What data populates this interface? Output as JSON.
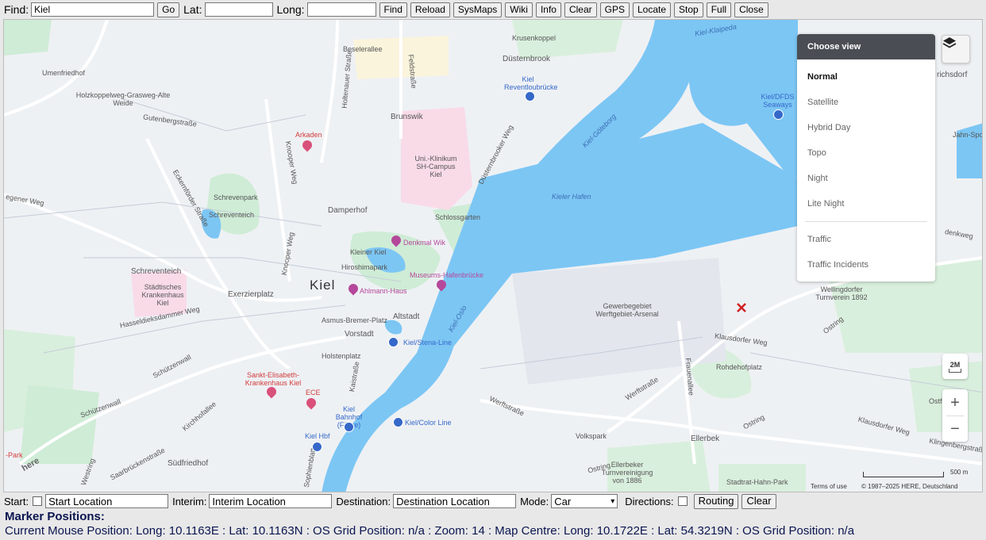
{
  "toolbar": {
    "find_label": "Find:",
    "find_value": "Kiel",
    "go": "Go",
    "lat_label": "Lat:",
    "lat_value": "",
    "long_label": "Long:",
    "long_value": "",
    "find_btn": "Find",
    "reload": "Reload",
    "sysmaps": "SysMaps",
    "wiki": "Wiki",
    "info": "Info",
    "clear": "Clear",
    "gps": "GPS",
    "locate": "Locate",
    "stop": "Stop",
    "full": "Full",
    "close": "Close"
  },
  "map": {
    "city": "Kiel",
    "labels": {
      "dusternbrook": "Düsternbrook",
      "brunswik": "Brunswik",
      "damperhof": "Damperhof",
      "schreventeich": "Schreventeich",
      "exerzierplatz": "Exerzierplatz",
      "altstadt": "Altstadt",
      "vorstadt": "Vorstadt",
      "suedfriedhof": "Südfriedhof",
      "ellerbek": "Ellerbek",
      "kieler_hafen": "Kieler Hafen",
      "schrevenpark": "Schrevenpark",
      "schreventeich_lake": "Schreventeich",
      "kleiner_kiel": "Kleiner Kiel",
      "hiroshimapark": "Hiroshimapark",
      "schlossgarten": "Schlossgarten",
      "uniklinikum": "Uni.-Klinikum SH-Campus Kiel",
      "krankenhaus": "Städtisches Krankenhaus Kiel",
      "elisabeth": "Sankt-Elisabeth-Krankenhaus Kiel",
      "ece": "ECE",
      "arkaden": "Arkaden",
      "denkmal": "Denkmal Wik",
      "ahlmann": "Ahlmann-Haus",
      "museums": "Museums-Hafenbrücke",
      "stena": "Kiel/Stena-Line",
      "color": "Kiel/Color Line",
      "bahnhof": "Kiel Bahnhof (Fähre)",
      "hbf": "Kiel Hbf",
      "reventlou": "Kiel Reventloubrücke",
      "dfds": "Kiel/DFDS Seaways",
      "gewerbe": "Gewerbegebiet Werftgebiet-Arsenal",
      "wellingdorfer": "Wellingdorfer Turnverein 1892",
      "rohdehof": "Rohdehofplatz",
      "volkspark": "Volkspark",
      "ostfriedhof": "Ostfriedhof",
      "ellerbeker": "Ellerbeker Turnvereinigung von 1886",
      "stadtrat": "Stadtrat-Hahn-Park",
      "umenfriedhof": "Umenfriedhof",
      "holzkoppel": "Holzkoppelweg-Grasweg-Alte Weide",
      "asmus": "Asmus-Bremer-Platz",
      "holstenplatz": "Holstenplatz",
      "krusenkoppel": "Krusenkoppel",
      "beselerallee": "Beselerallee",
      "gutenbergstrasse": "Gutenbergstraße",
      "hasseldieksdammer": "Hasseldieksdammer Weg",
      "schuetzenwall": "Schützenwall",
      "kirchhofallee": "Kirchhofallee",
      "westring": "Westring",
      "saarbruecken": "Saarbrückenstraße",
      "werftstrasse": "Werftstraße",
      "klausdorfer": "Klausdorfer Weg",
      "ostring": "Ostring",
      "klingenberg": "Klingenbergstraße",
      "duesternbrooker_weg": "Düsternbrooker Weg",
      "kieler_goeteborg": "Kiel-Göteborg",
      "kiel_oslo": "Kiel-Oslo",
      "kiel_klaipeda": "Kiel-Klaipeda",
      "richsdorf": "richsdorf",
      "jahn": "Jahn-Sport",
      "eckernfoerder": "Eckernförder Straße",
      "holtenauer": "Holtenauer Straße",
      "knooper": "Knooper Weg",
      "feldstrasse": "Feldstraße",
      "sophienblatt": "Sophienblatt",
      "kaistrasse": "Kaistraße",
      "frauenallee": "Frauenallee",
      "gegener": "egener Weg",
      "dendweg": "denkweg",
      "ostpark": "-Park",
      "here": "here"
    },
    "view_panel": {
      "title": "Choose view",
      "options": [
        "Normal",
        "Satellite",
        "Hybrid Day",
        "Topo",
        "Night",
        "Lite Night"
      ],
      "overlays": [
        "Traffic",
        "Traffic Incidents"
      ],
      "selected": "Normal"
    },
    "zoom_plus": "+",
    "zoom_minus": "−",
    "minimap_label": "2M",
    "scale_label": "500 m",
    "terms": "Terms of use",
    "copyright": "© 1987–2025 HERE, Deutschland"
  },
  "route": {
    "start_label": "Start:",
    "start_placeholder": "Start Location",
    "interim_label": "Interim:",
    "interim_placeholder": "Interim Location",
    "destination_label": "Destination:",
    "destination_placeholder": "Destination Location",
    "mode_label": "Mode:",
    "mode_value": "Car",
    "directions_label": "Directions:",
    "routing": "Routing",
    "clear": "Clear"
  },
  "markers_title": "Marker Positions:",
  "status_line": "Current Mouse Position: Long: 10.1163E : Lat: 10.1163N : OS Grid Position: n/a : Zoom: 14 : Map Centre: Long: 10.1722E : Lat: 54.3219N : OS Grid Position: n/a",
  "colors": {
    "water": "#7cc6f4",
    "park": "#cfecd6",
    "road": "#ffffff",
    "status_text": "#0a1550"
  }
}
